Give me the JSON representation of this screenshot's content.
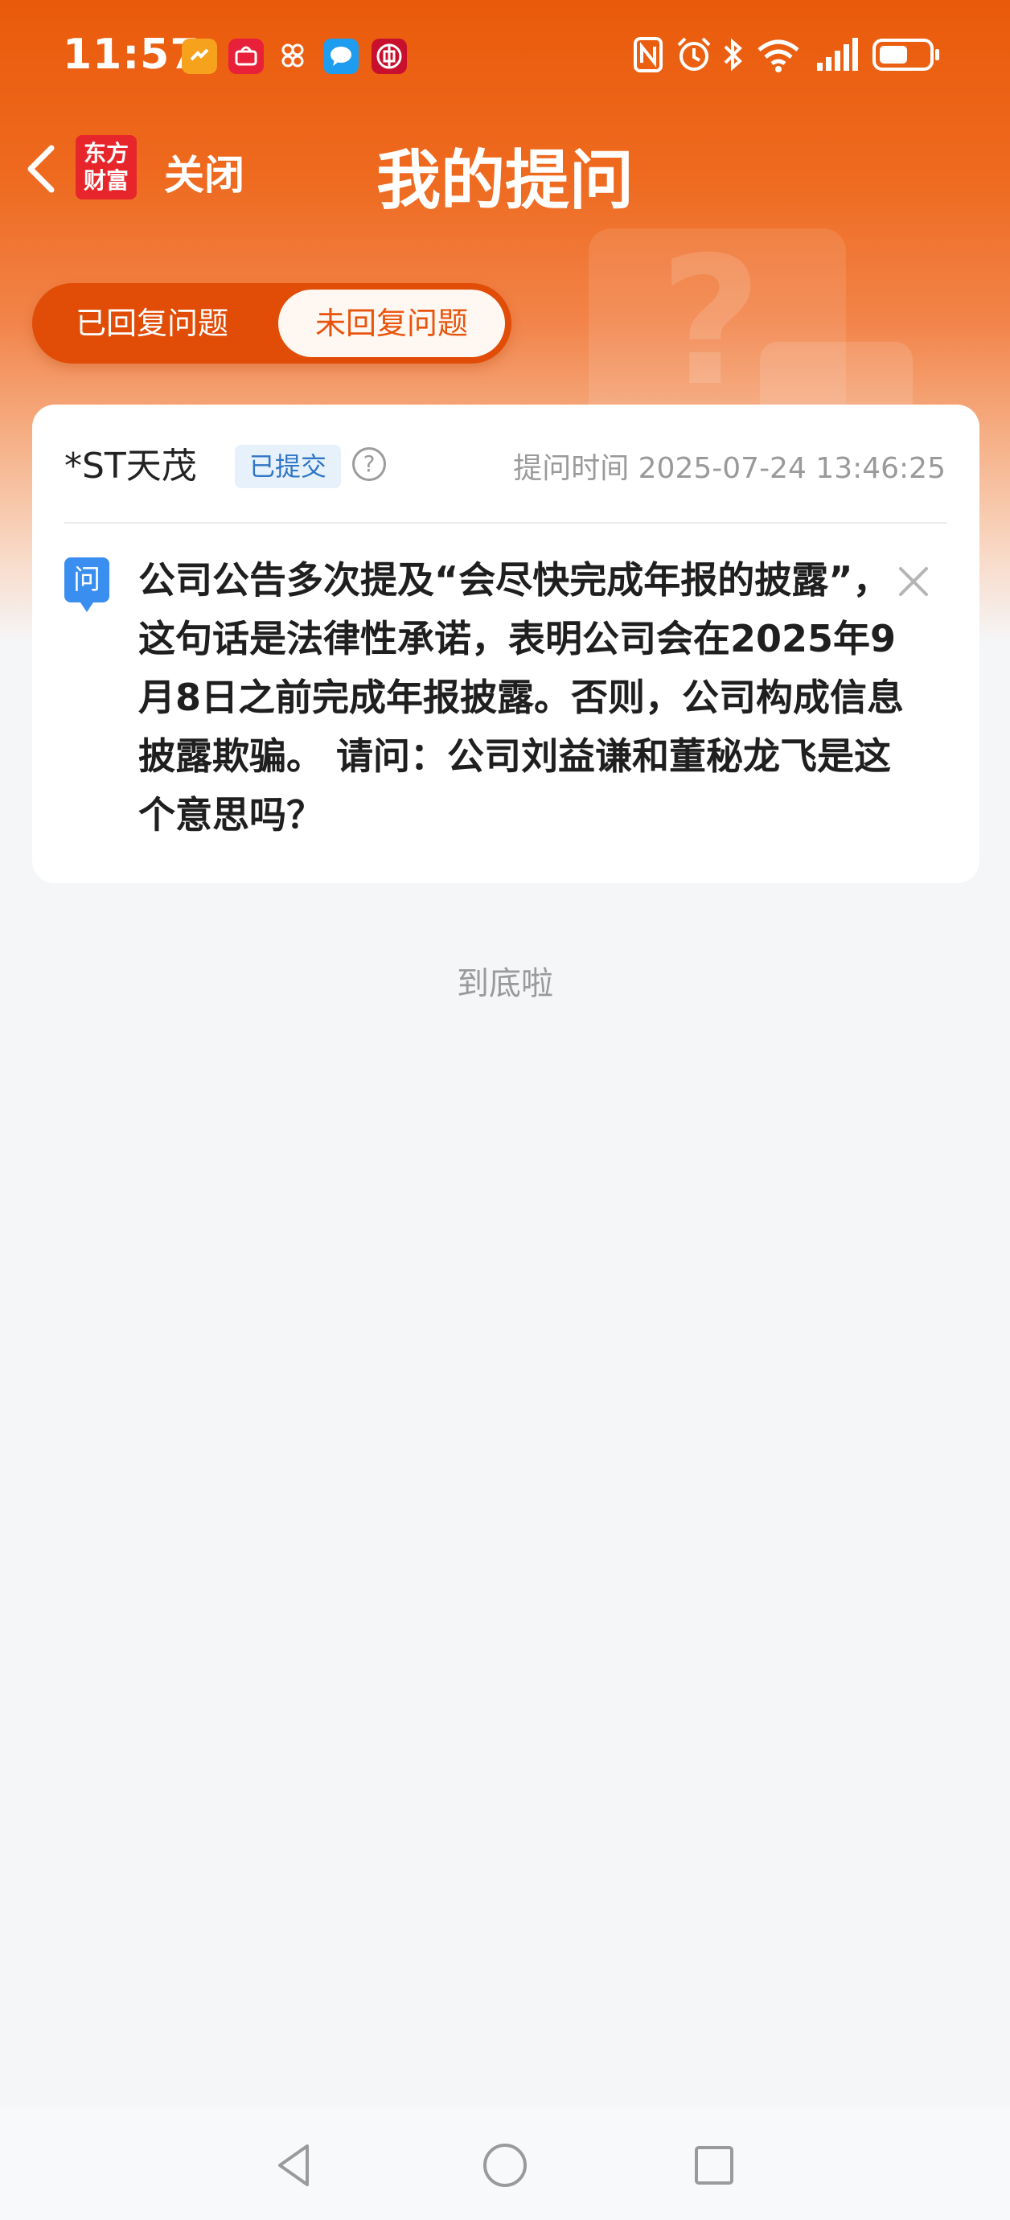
{
  "status_bar": {
    "time": "11:57",
    "app_icons": [
      "health-app-icon",
      "huawei-store-icon",
      "cluster-icon",
      "message-icon",
      "bank-icon"
    ],
    "system_icons": [
      "nfc-icon",
      "alarm-icon",
      "bluetooth-icon",
      "wifi-icon",
      "signal-icon",
      "battery-icon"
    ]
  },
  "nav": {
    "brand_line1": "东方",
    "brand_line2": "财富",
    "close_label": "关闭",
    "title": "我的提问"
  },
  "tabs": [
    {
      "label": "已回复问题",
      "active": false
    },
    {
      "label": "未回复问题",
      "active": true
    }
  ],
  "question_card": {
    "stock_name": "*ST天茂",
    "status": "已提交",
    "help_symbol": "?",
    "ask_time": "提问时间 2025-07-24 13:46:25",
    "q_badge": "问",
    "question_text": "公司公告多次提及“会尽快完成年报的披露”，这句话是法律性承诺，表明公司会在2025年9月8日之前完成年报披露。否则，公司构成信息披露欺骗。 请问：公司刘益谦和董秘龙飞是这个意思吗？"
  },
  "footer": {
    "end_text": "到底啦"
  },
  "colors": {
    "header_orange": "#ea5a0b",
    "active_tab_text": "#e8540c",
    "badge_blue": "#3a8ef0",
    "status_badge_text": "#2f76c4"
  }
}
